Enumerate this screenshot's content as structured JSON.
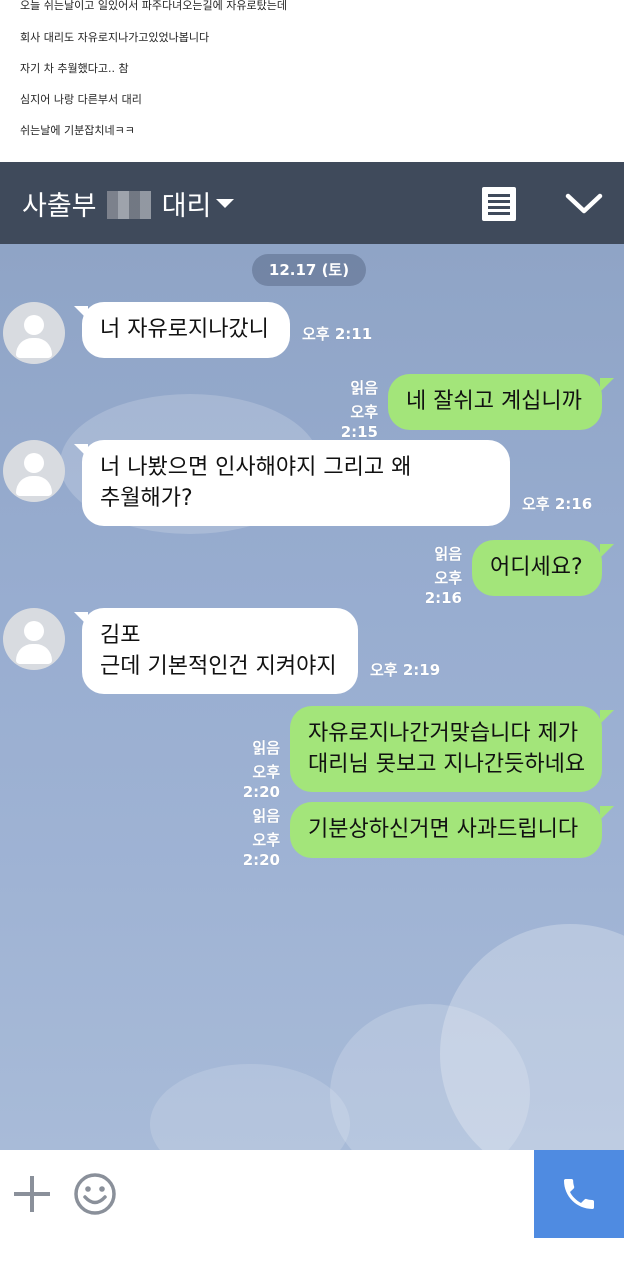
{
  "caption": {
    "lines": [
      "오늘 쉬는날이고 일있어서 파주다녀오는길에 자유로탔는데",
      "회사 대리도 자유로지나가고있었나봅니다",
      "자기 차 추월했다고.. 참",
      "심지어 나랑 다른부서 대리",
      "쉬는날에 기분잡치네ㅋㅋ"
    ]
  },
  "header": {
    "title_prefix": "사출부",
    "title_suffix": "대리",
    "icons": [
      "chevron-down-icon",
      "menu-icon",
      "collapse-icon"
    ],
    "background": "#3f4a5b"
  },
  "chat": {
    "date": "12.17 (토)",
    "read_label": "읽음",
    "messages": [
      {
        "side": "in",
        "lines": [
          "너 자유로지나갔니"
        ],
        "time": "오후 2:11"
      },
      {
        "side": "out",
        "lines": [
          "네 잘쉬고 계십니까"
        ],
        "time": "오후 2:15",
        "read": "읽음"
      },
      {
        "side": "in",
        "lines": [
          "너 나봤으면 인사해야지 그리고 왜",
          "추월해가?"
        ],
        "time": "오후 2:16"
      },
      {
        "side": "out",
        "lines": [
          "어디세요?"
        ],
        "time": "오후 2:16",
        "read": "읽음"
      },
      {
        "side": "in",
        "lines": [
          "김포",
          "근데 기본적인건 지켜야지"
        ],
        "time": "오후 2:19"
      },
      {
        "side": "out",
        "lines": [
          "자유로지나간거맞습니다 제가",
          "대리님 못보고 지나간듯하네요"
        ],
        "time": "오후 2:20",
        "read": "읽음"
      },
      {
        "side": "out",
        "lines": [
          "기분상하신거면 사과드립니다"
        ],
        "time": "오후 2:20",
        "read": "읽음"
      }
    ],
    "colors": {
      "incoming": "#ffffff",
      "outgoing": "#a3e57a",
      "background": "#98add0"
    }
  },
  "input_bar": {
    "icons": [
      "plus-icon",
      "emoji-icon",
      "phone-icon"
    ],
    "call_color": "#4f8be1"
  }
}
